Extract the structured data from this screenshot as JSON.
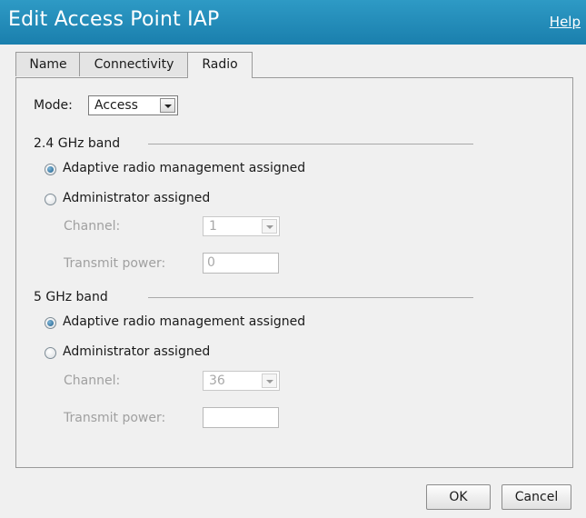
{
  "dialog": {
    "title": "Edit Access Point IAP",
    "help_label": "Help"
  },
  "tabs": [
    {
      "label": "Name",
      "active": false
    },
    {
      "label": "Connectivity",
      "active": false
    },
    {
      "label": "Radio",
      "active": true
    }
  ],
  "mode": {
    "label": "Mode:",
    "value": "Access"
  },
  "band_24": {
    "title": "2.4 GHz band",
    "option_arm": {
      "label": "Adaptive radio management assigned",
      "checked": true
    },
    "option_admin": {
      "label": "Administrator assigned",
      "checked": false
    },
    "channel_label": "Channel:",
    "channel_value": "1",
    "power_label": "Transmit power:",
    "power_value": "0"
  },
  "band_5": {
    "title": "5 GHz band",
    "option_arm": {
      "label": "Adaptive radio management assigned",
      "checked": true
    },
    "option_admin": {
      "label": "Administrator assigned",
      "checked": false
    },
    "channel_label": "Channel:",
    "channel_value": "36",
    "power_label": "Transmit power:",
    "power_value": ""
  },
  "buttons": {
    "ok": "OK",
    "cancel": "Cancel"
  },
  "colors": {
    "titlebar": "#1f88b8",
    "panel_bg": "#f0f0f0",
    "disabled_text": "#a0a0a0"
  }
}
